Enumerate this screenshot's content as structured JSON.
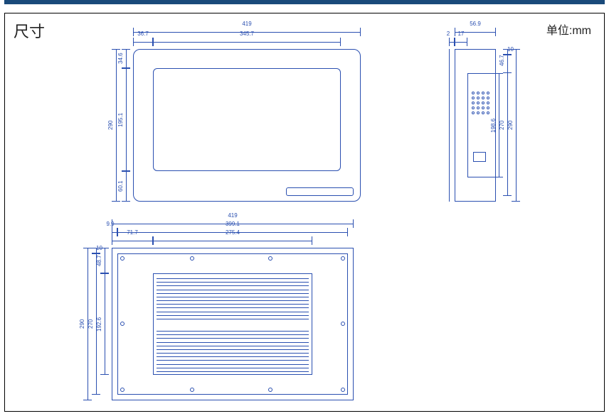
{
  "labels": {
    "title": "尺寸",
    "unit": "单位:mm"
  },
  "front": {
    "overall_w": "419",
    "bezel_side": "36.7",
    "screen_w": "345.7",
    "overall_h": "290",
    "screen_h": "195.1",
    "bezel_top": "34.6",
    "bezel_bottom": "60.1"
  },
  "side": {
    "depth": "56.9",
    "front_thick": "2",
    "chamfer": "17",
    "h_total": "290",
    "h_mount": "270",
    "h_chassis": "198.6",
    "h_top_gap": "46.7",
    "h_edge": "10"
  },
  "rear": {
    "overall_w": "419",
    "mount_w": "399.1",
    "heatsink_w": "275.4",
    "offset_l": "9.9",
    "heatsink_off": "71.7",
    "overall_h": "290",
    "mount_h": "270",
    "heatsink_h": "192.6",
    "top_gap": "48.7",
    "edge": "10"
  }
}
